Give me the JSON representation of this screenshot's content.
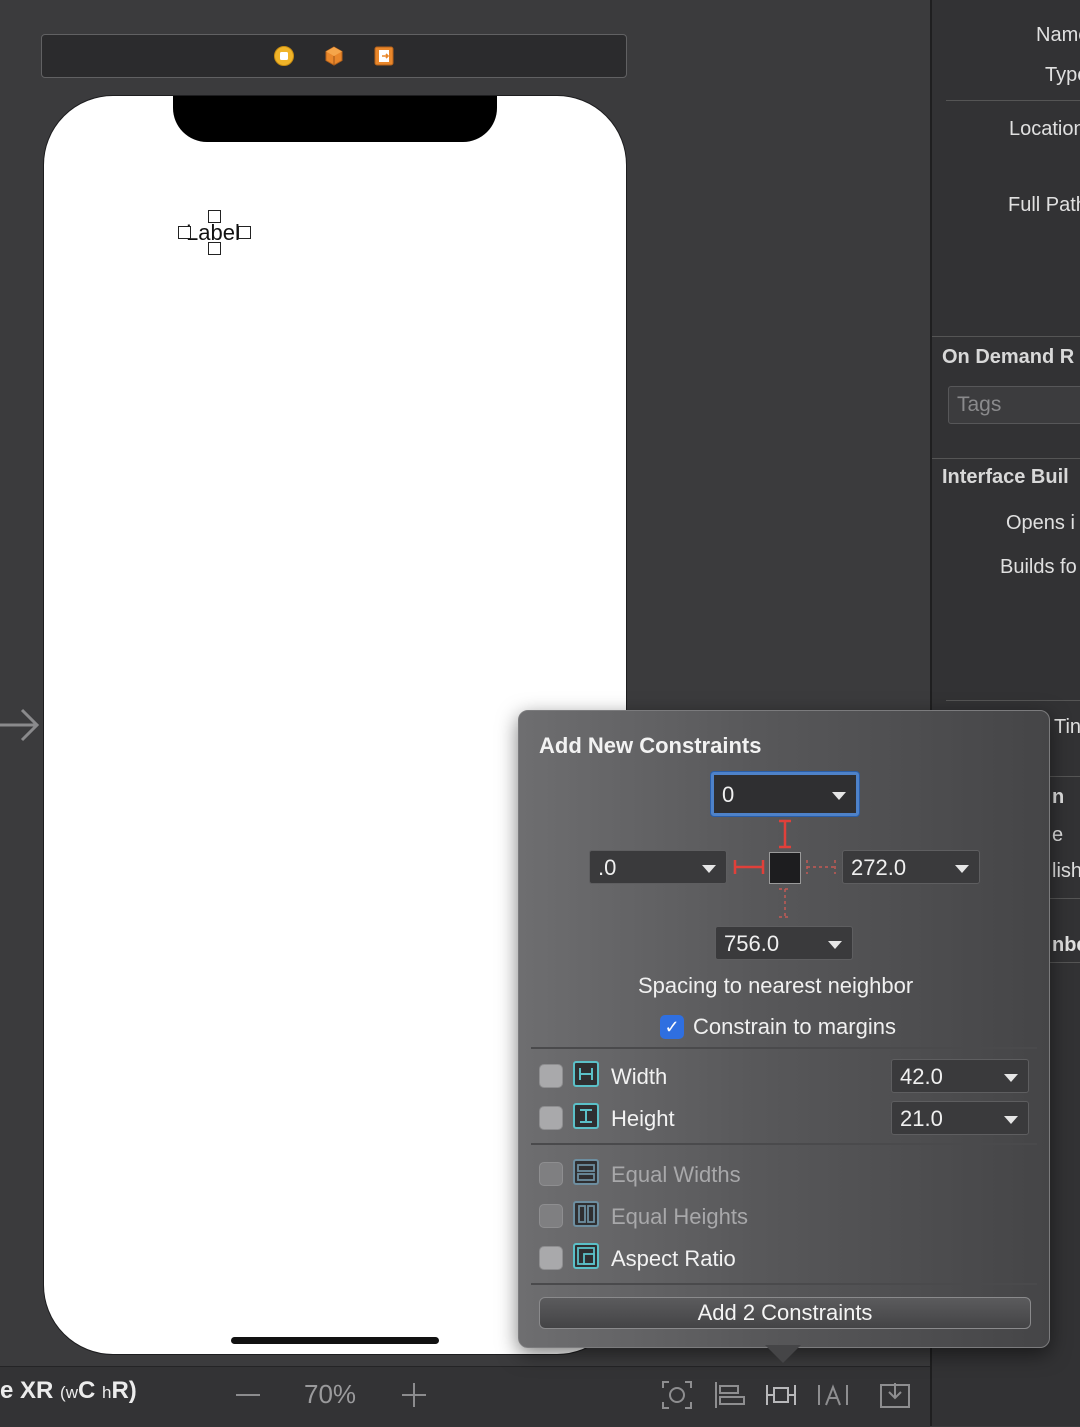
{
  "canvas": {
    "label_text": "Label",
    "scene_icons": [
      "view-controller-icon",
      "first-responder-icon",
      "exit-icon"
    ]
  },
  "inspector": {
    "rows": [
      "Name",
      "Type",
      "Location",
      "Full Path",
      "Opens i",
      "Builds fo"
    ],
    "sections": [
      "On Demand R",
      "Interface Buil"
    ],
    "tags_placeholder": "Tags",
    "partial": [
      "Tin",
      "n",
      "e",
      "lish",
      "nbe"
    ]
  },
  "bottom_bar": {
    "device_prefix": "e XR",
    "device_sizes": [
      "(w",
      "C",
      "h",
      "R)"
    ],
    "zoom": "70%"
  },
  "popover": {
    "title": "Add New Constraints",
    "top_value": "0",
    "left_value": ".0",
    "right_value": "272.0",
    "bottom_value": "756.0",
    "spacing_label": "Spacing to nearest neighbor",
    "constrain_margins": "Constrain to margins",
    "width_label": "Width",
    "width_value": "42.0",
    "height_label": "Height",
    "height_value": "21.0",
    "equal_widths": "Equal Widths",
    "equal_heights": "Equal Heights",
    "aspect_ratio": "Aspect Ratio",
    "add_button": "Add 2 Constraints"
  },
  "colors": {
    "accent": "#4e82c9",
    "constraint_red": "#e0403a",
    "checkbox_blue": "#2f6fe0"
  }
}
